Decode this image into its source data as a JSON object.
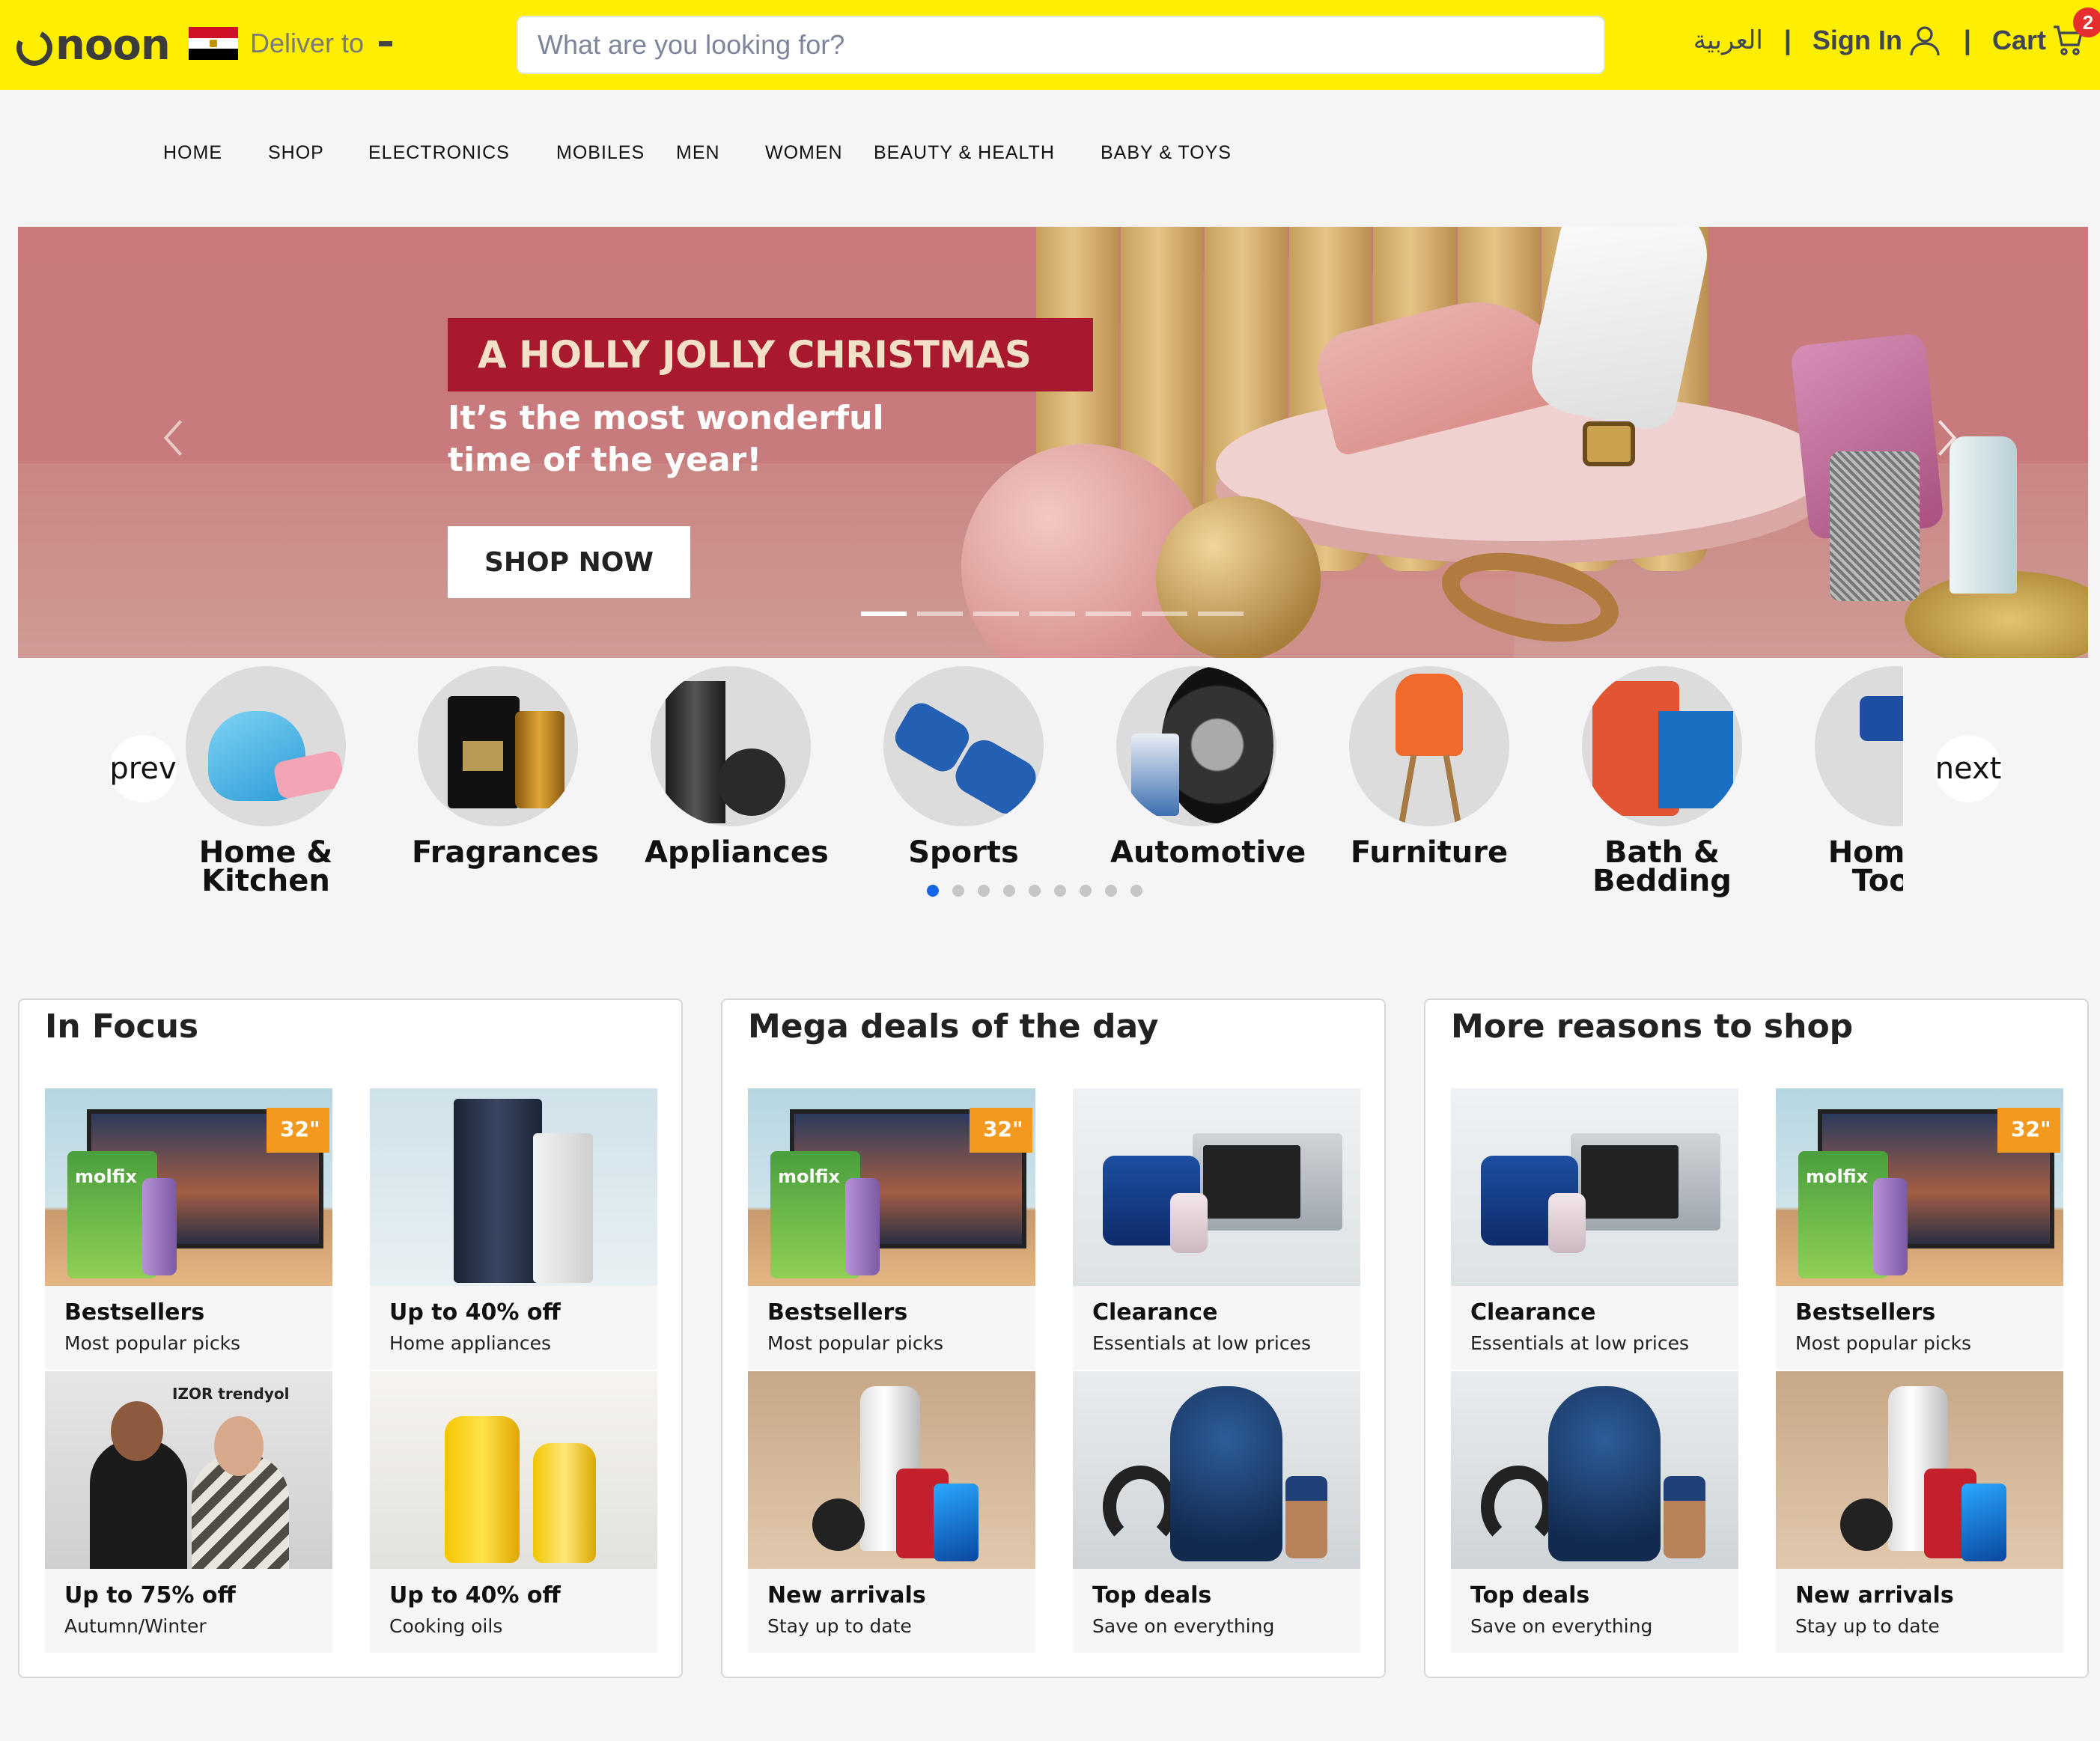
{
  "header": {
    "logo": "noon",
    "deliver_label": "Deliver to",
    "search_placeholder": "What are you looking for?",
    "language": "العربية",
    "sep1": "|",
    "sign_in": "Sign In",
    "sep2": "|",
    "cart_label": "Cart",
    "cart_count": "2",
    "brand_color": "#feee00"
  },
  "nav": {
    "items": [
      "HOME",
      "SHOP",
      "ELECTRONICS",
      "MOBILES",
      "MEN",
      "WOMEN",
      "BEAUTY & HEALTH",
      "BABY & TOYS"
    ]
  },
  "hero": {
    "tag": "A HOLLY JOLLY CHRISTMAS",
    "subtitle_1": "It’s the most wonderful",
    "subtitle_2": "time of the year!",
    "cta": "SHOP NOW",
    "slide_count": 7,
    "active_slide": 1
  },
  "categories": {
    "prev": "prev",
    "next": "next",
    "items": [
      {
        "l1": "Home &",
        "l2": "Kitchen"
      },
      {
        "l1": "Fragrances",
        "l2": ""
      },
      {
        "l1": "Appliances",
        "l2": ""
      },
      {
        "l1": "Sports",
        "l2": ""
      },
      {
        "l1": "Automotive",
        "l2": ""
      },
      {
        "l1": "Furniture",
        "l2": ""
      },
      {
        "l1": "Bath &",
        "l2": "Bedding"
      },
      {
        "l1": "Home &",
        "l2": "Tools"
      }
    ],
    "page_count": 9,
    "active_page": 1,
    "active_color": "#1565e6"
  },
  "cards": [
    {
      "title": "In Focus",
      "tiles": [
        {
          "t1": "Bestsellers",
          "t2": "Most popular picks",
          "img": "tv"
        },
        {
          "t1": "Up to 40% off",
          "t2": "Home appliances",
          "img": "fridge"
        },
        {
          "t1": "Up to 75% off",
          "t2": "Autumn/Winter",
          "img": "fashion"
        },
        {
          "t1": "Up to 40% off",
          "t2": "Cooking oils",
          "img": "oil"
        }
      ]
    },
    {
      "title": "Mega deals of the day",
      "tiles": [
        {
          "t1": "Bestsellers",
          "t2": "Most popular picks",
          "img": "tv"
        },
        {
          "t1": "Clearance",
          "t2": "Essentials at low prices",
          "img": "drill"
        },
        {
          "t1": "New arrivals",
          "t2": "Stay up to date",
          "img": "blender"
        },
        {
          "t1": "Top deals",
          "t2": "Save on everything",
          "img": "vac"
        }
      ]
    },
    {
      "title": "More reasons to shop",
      "tiles": [
        {
          "t1": "Clearance",
          "t2": "Essentials at low prices",
          "img": "drill"
        },
        {
          "t1": "Bestsellers",
          "t2": "Most popular picks",
          "img": "tv"
        },
        {
          "t1": "Top deals",
          "t2": "Save on everything",
          "img": "vac"
        },
        {
          "t1": "New arrivals",
          "t2": "Stay up to date",
          "img": "blender"
        }
      ]
    }
  ],
  "tile_text": {
    "tv_size": "32\"",
    "fashion_brands": "IZOR trendyol"
  }
}
